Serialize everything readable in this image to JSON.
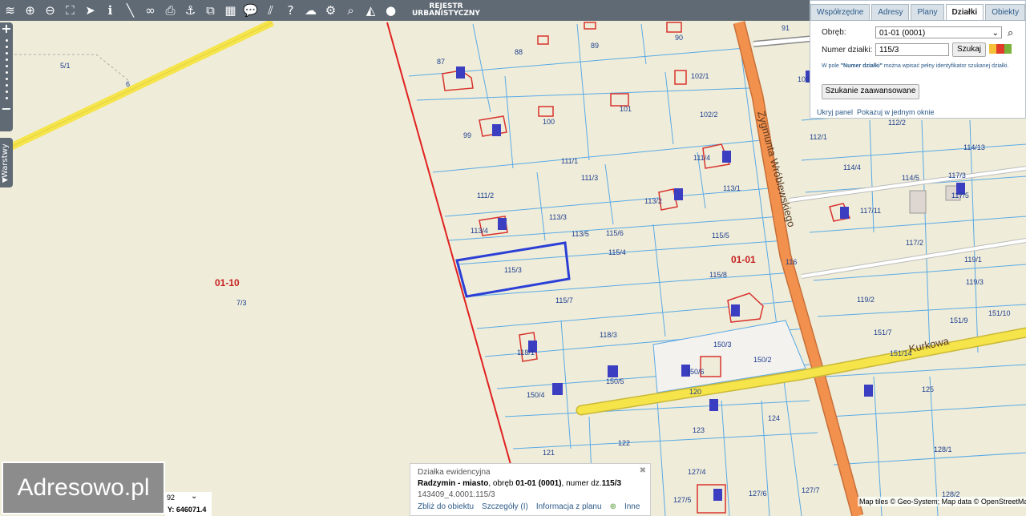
{
  "toolbar": {
    "icons": [
      "layers-icon",
      "zoom-in-icon",
      "zoom-out-icon",
      "full-extent-icon",
      "pointer-icon",
      "info-icon",
      "measure-line-icon",
      "link-icon",
      "print-icon",
      "anchor-icon",
      "share-icon",
      "layout-icon",
      "comment-icon",
      "hatch-icon",
      "help-icon",
      "upload-icon",
      "settings-icon",
      "search-icon",
      "compass-icon",
      "user-icon"
    ],
    "glyphs": [
      "≋",
      "⊕",
      "⊖",
      "⛶",
      "➤",
      "ℹ",
      "╲",
      "∞",
      "⎙",
      "⚓",
      "⧉",
      "▦",
      "💬",
      "⫽",
      "?",
      "☁",
      "⚙",
      "⌕",
      "◭",
      "●"
    ],
    "logo_line1": "REJESTR",
    "logo_line2": "URBANISTYCZNY"
  },
  "zoom": {
    "plus": "+",
    "minus": "−"
  },
  "layers_tab": {
    "label": "Warstwy",
    "arrow": "▶"
  },
  "panel": {
    "tabs": [
      "Współrzędne",
      "Adresy",
      "Plany",
      "Działki",
      "Obiekty"
    ],
    "active_tab": "Działki",
    "obreb_label": "Obręb:",
    "obreb_value": "01-01 (0001)",
    "numer_label": "Numer działki:",
    "numer_value": "115/3",
    "search_button": "Szukaj",
    "hint_prefix": "W pole ",
    "hint_bold": "\"Numer działki\"",
    "hint_suffix": " można wpisać pełny identyfikator szukanej działki.",
    "advanced_button": "Szukanie zaawansowane",
    "hide_link": "Ukryj panel",
    "single_window_link": "Pokazuj w jednym oknie"
  },
  "logo": {
    "text": "Adresowo.pl"
  },
  "coords": {
    "epsg_fragment": "92",
    "y_label": "Y:",
    "y_value": "646071.4"
  },
  "info": {
    "title": "Działka ewidencyjna",
    "place": "Radzymin - miasto",
    "obreb_text": ", obręb ",
    "obreb": "01-01 (0001)",
    "numer_text": ", numer dz.",
    "numer": "115/3",
    "identifier": "143409_4.0001.115/3",
    "links": [
      "Zbliż do obiektu",
      "Szczegóły (I)",
      "Informacja z planu",
      "Inne"
    ],
    "close": "✖"
  },
  "attribution": "Map tiles © Geo-System; Map data © OpenStreetMap",
  "map": {
    "region_labels": [
      "01-10",
      "01-01"
    ],
    "street_labels": [
      "Zygmunta Wróblewskiego",
      "Kurkowa"
    ],
    "parcel_labels": [
      "5/1",
      "87",
      "88",
      "89",
      "90",
      "91",
      "99",
      "100",
      "101",
      "102/1",
      "102/2",
      "103",
      "111/1",
      "111/2",
      "111/3",
      "111/4",
      "112/1",
      "112/2",
      "113/1",
      "113/2",
      "113/3",
      "113/4",
      "113/5",
      "114/4",
      "114/5",
      "114/13",
      "115/3",
      "115/4",
      "115/5",
      "115/6",
      "115/7",
      "115/8",
      "116",
      "117/2",
      "117/3",
      "117/5",
      "117/11",
      "118/1",
      "118/3",
      "119/1",
      "119/2",
      "119/3",
      "121",
      "122",
      "123",
      "124",
      "125",
      "127/4",
      "127/5",
      "127/6",
      "127/7",
      "128/1",
      "128/2",
      "150/2",
      "150/3",
      "150/4",
      "150/5",
      "150/6",
      "151/7",
      "151/9",
      "151/10",
      "151/14",
      "7/3",
      "6",
      "120"
    ],
    "building_codes": [
      "m1",
      "m2",
      "m1",
      "m2",
      "m1",
      "m1",
      "m2",
      "m1",
      "m2",
      "m2",
      "m1",
      "m2",
      "m1",
      "m1",
      "m1",
      "m1",
      "m1",
      "m1"
    ],
    "selected_parcel": "115/3",
    "colors": {
      "background": "#efedd9",
      "parcel_line": "#5aa9e6",
      "selected": "#2b3fd6",
      "boundary": "#e02020",
      "road_main": "#f2914e",
      "road_secondary": "#f5e44a",
      "building": "#d8332e",
      "label_parcel": "#1e3d8f",
      "label_region": "#c52020"
    }
  }
}
